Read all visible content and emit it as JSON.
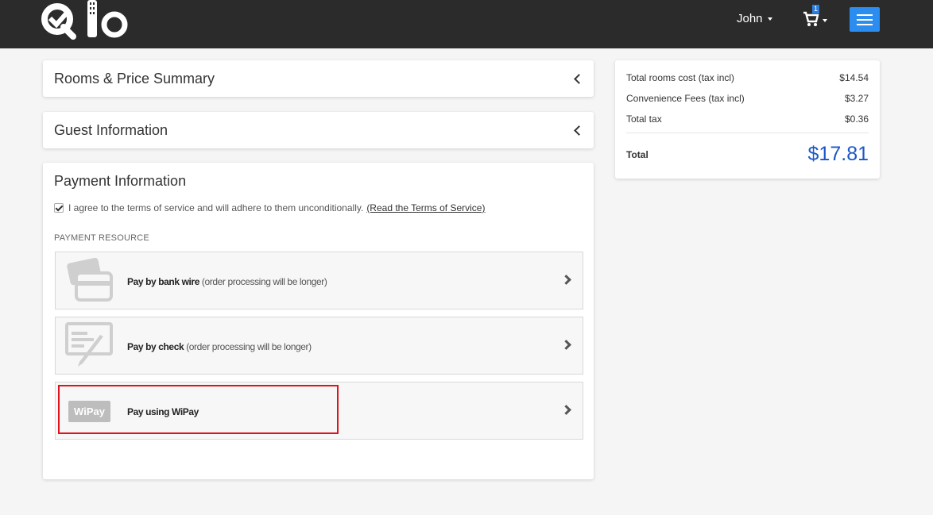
{
  "header": {
    "user_name": "John",
    "cart_count": "1"
  },
  "sections": {
    "rooms_summary": "Rooms & Price Summary",
    "guest_info": "Guest Information",
    "payment_info": "Payment Information"
  },
  "payment": {
    "terms_text": "I agree to the terms of service and will adhere to them unconditionally.",
    "terms_link": "(Read the Terms of Service)",
    "resource_label": "PAYMENT RESOURCE",
    "options": [
      {
        "title": "Pay by bank wire",
        "note": "(order processing will be longer)"
      },
      {
        "title": "Pay by check",
        "note": "(order processing will be longer)"
      },
      {
        "title": "Pay using WiPay",
        "note": "",
        "logo_text": "WiPay"
      }
    ]
  },
  "summary": {
    "rows": [
      {
        "label": "Total rooms cost (tax incl)",
        "value": "$14.54"
      },
      {
        "label": "Convenience Fees (tax incl)",
        "value": "$3.27"
      },
      {
        "label": "Total tax",
        "value": "$0.36"
      }
    ],
    "total_label": "Total",
    "total_value": "$17.81"
  },
  "colors": {
    "header_bg": "#2b2b2b",
    "accent_blue": "#2b8df0",
    "total_blue": "#1a58c9",
    "highlight_red": "#e0121b"
  }
}
